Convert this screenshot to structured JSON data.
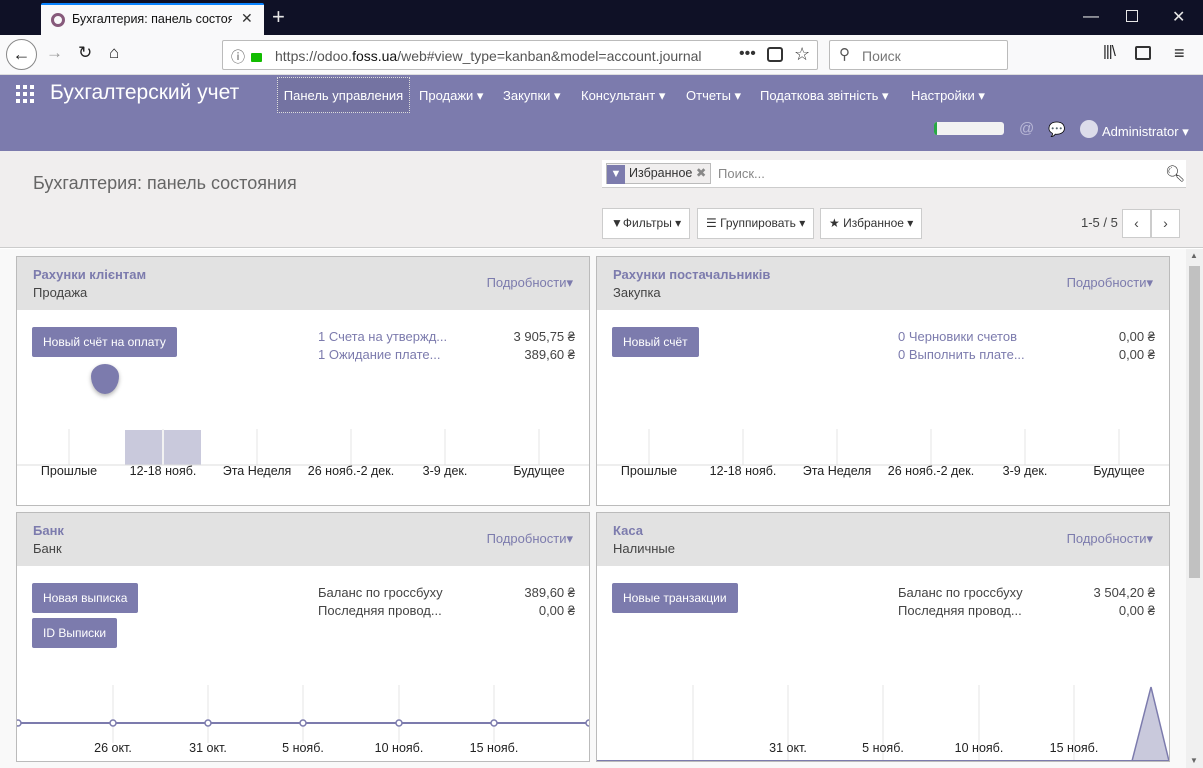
{
  "browser": {
    "tab_title": "Бухгалтерия: панель состояния",
    "url_prefix": "https://odoo.",
    "url_domain": "foss.ua",
    "url_path": "/web#view_type=kanban&model=account.journal",
    "search_placeholder": "Поиск"
  },
  "odoo": {
    "app_title": "Бухгалтерский учет",
    "menu": [
      {
        "label": "Панель управления"
      },
      {
        "label": "Продажи ▾"
      },
      {
        "label": "Закупки ▾"
      },
      {
        "label": "Консультант ▾"
      },
      {
        "label": "Отчеты ▾"
      },
      {
        "label": "Податкова звітність ▾"
      },
      {
        "label": "Настройки ▾"
      }
    ],
    "user": "Administrator",
    "progress": 0.04
  },
  "control": {
    "breadcrumb": "Бухгалтерия: панель состояния",
    "facet": "Избранное",
    "search_placeholder": "Поиск...",
    "filters": "Фильтры",
    "groupby": "Группировать",
    "favorites": "Избранное",
    "pager": "1-5 / 5"
  },
  "cards": [
    {
      "title": "Рахунки клієнтам",
      "sub": "Продажа",
      "more": "Подробности▾",
      "button": "Новый счёт на оплату",
      "stats": [
        {
          "label": "1 Счета на утвержд...",
          "value": "3 905,75 ₴"
        },
        {
          "label": "1 Ожидание плате...",
          "value": "389,60 ₴"
        }
      ],
      "graph_labels": [
        "Прошлые",
        "12-18 нояб.",
        "Эта Неделя",
        "26 нояб.-2 дек.",
        "3-9 дек.",
        "Будущее"
      ]
    },
    {
      "title": "Рахунки постачальників",
      "sub": "Закупка",
      "more": "Подробности▾",
      "button": "Новый счёт",
      "stats": [
        {
          "label": "0 Черновики счетов",
          "value": "0,00 ₴"
        },
        {
          "label": "0 Выполнить плате...",
          "value": "0,00 ₴"
        }
      ],
      "graph_labels": [
        "Прошлые",
        "12-18 нояб.",
        "Эта Неделя",
        "26 нояб.-2 дек.",
        "3-9 дек.",
        "Будущее"
      ]
    },
    {
      "title": "Банк",
      "sub": "Банк",
      "more": "Подробности▾",
      "button": "Новая выписка",
      "button2": "ID Выписки",
      "stats": [
        {
          "label": "Баланс по гроссбуху",
          "value": "389,60 ₴"
        },
        {
          "label": "Последняя провод...",
          "value": "0,00 ₴"
        }
      ],
      "graph_labels": [
        "26 окт.",
        "31 окт.",
        "5 нояб.",
        "10 нояб.",
        "15 нояб."
      ]
    },
    {
      "title": "Каса",
      "sub": "Наличные",
      "more": "Подробности▾",
      "button": "Новые транзакции",
      "stats": [
        {
          "label": "Баланс по гроссбуху",
          "value": "3 504,20 ₴"
        },
        {
          "label": "Последняя провод...",
          "value": "0,00 ₴"
        }
      ],
      "graph_labels": [
        "31 окт.",
        "5 нояб.",
        "10 нояб.",
        "15 нояб."
      ]
    }
  ],
  "colors": {
    "brand": "#7c7bad",
    "accent": "#875a7b",
    "progress": "#28a745"
  }
}
